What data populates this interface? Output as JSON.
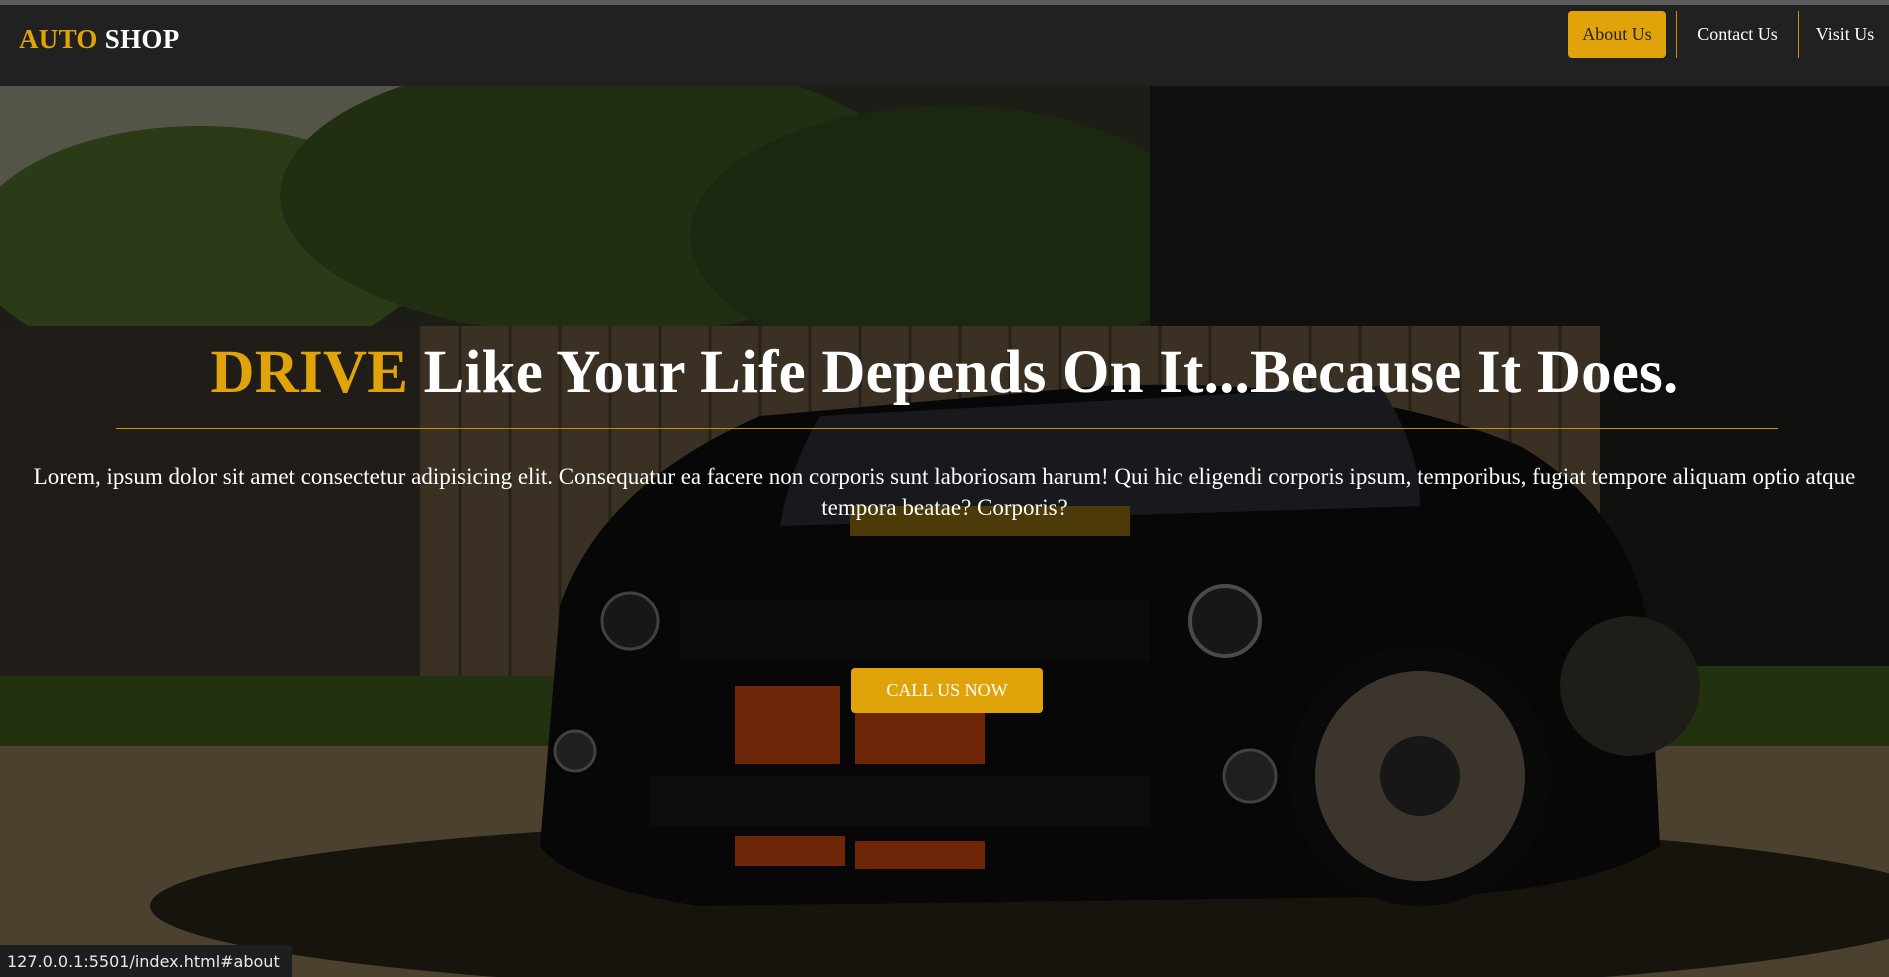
{
  "brand": {
    "accent": "AUTO",
    "rest": "SHOP"
  },
  "nav": {
    "items": [
      {
        "label": "About Us",
        "active": true
      },
      {
        "label": "Contact Us",
        "active": false
      },
      {
        "label": "Visit Us",
        "active": false
      }
    ]
  },
  "hero": {
    "headline_accent": "DRIVE",
    "headline_rest": " Like Your Life Depends On It...Because It Does.",
    "lead": "Lorem, ipsum dolor sit amet consectetur adipisicing elit. Consequatur ea facere non corporis sunt laboriosam harum! Qui hic eligendi corporis ipsum, temporibus, fugiat tempore aliquam optio atque tempora beatae? Corporis?",
    "cta_label": "CALL US NOW"
  },
  "status_bar": {
    "url": "127.0.0.1:5501/index.html#about"
  },
  "colors": {
    "accent": "#e0a40a",
    "navbar": "#212121",
    "text": "#ffffff"
  }
}
